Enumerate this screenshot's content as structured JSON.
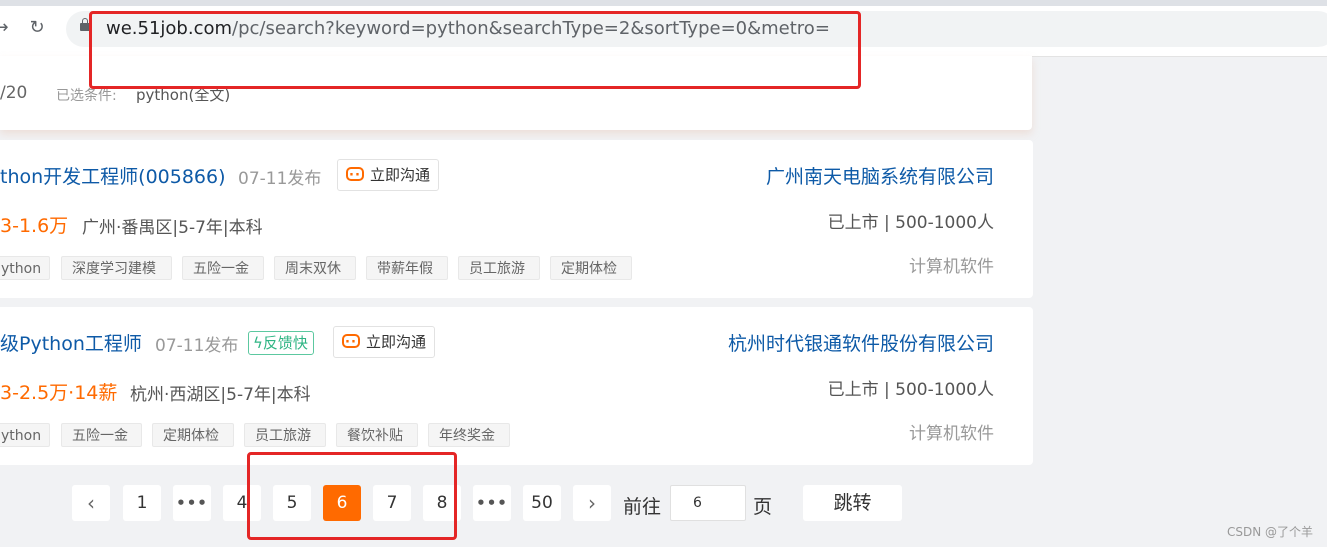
{
  "browser": {
    "url_host": "we.51job.com",
    "url_path": "/pc/search?keyword=python&searchType=2&sortType=0&metro="
  },
  "filter": {
    "count_text": "/20",
    "selected_label": "已选条件:",
    "selected_value": "python(全文)"
  },
  "jobs": [
    {
      "title": "thon开发工程师(005866)",
      "date": "07-11发布",
      "badge": "",
      "chat_label": "立即沟通",
      "salary": "3-1.6万",
      "location": "广州·番禺区|5-7年|本科",
      "tags": [
        "ython",
        "深度学习建模",
        "五险一金",
        "周末双休",
        "带薪年假",
        "员工旅游",
        "定期体检"
      ],
      "company": "广州南天电脑系统有限公司",
      "scale": "已上市 | 500-1000人",
      "industry": "计算机软件"
    },
    {
      "title": "级Python工程师",
      "date": "07-11发布",
      "badge": "反馈快",
      "chat_label": "立即沟通",
      "salary": "3-2.5万·14薪",
      "location": "杭州·西湖区|5-7年|本科",
      "tags": [
        "ython",
        "五险一金",
        "定期体检",
        "员工旅游",
        "餐饮补贴",
        "年终奖金"
      ],
      "company": "杭州时代银通软件股份有限公司",
      "scale": "已上市 | 500-1000人",
      "industry": "计算机软件"
    }
  ],
  "pagination": {
    "prev": "‹",
    "next": "›",
    "pages": [
      "1",
      "•••",
      "4",
      "5",
      "6",
      "7",
      "8",
      "•••",
      "50"
    ],
    "active": "6",
    "goto_label": "前往",
    "goto_value": "6",
    "page_suffix": "页",
    "jump_label": "跳转"
  },
  "watermark": "CSDN @了个羊",
  "colors": {
    "accent": "#ff6a00",
    "link": "#0e5aa7",
    "annotation": "#e42626",
    "fast_badge": "#2fb584"
  }
}
